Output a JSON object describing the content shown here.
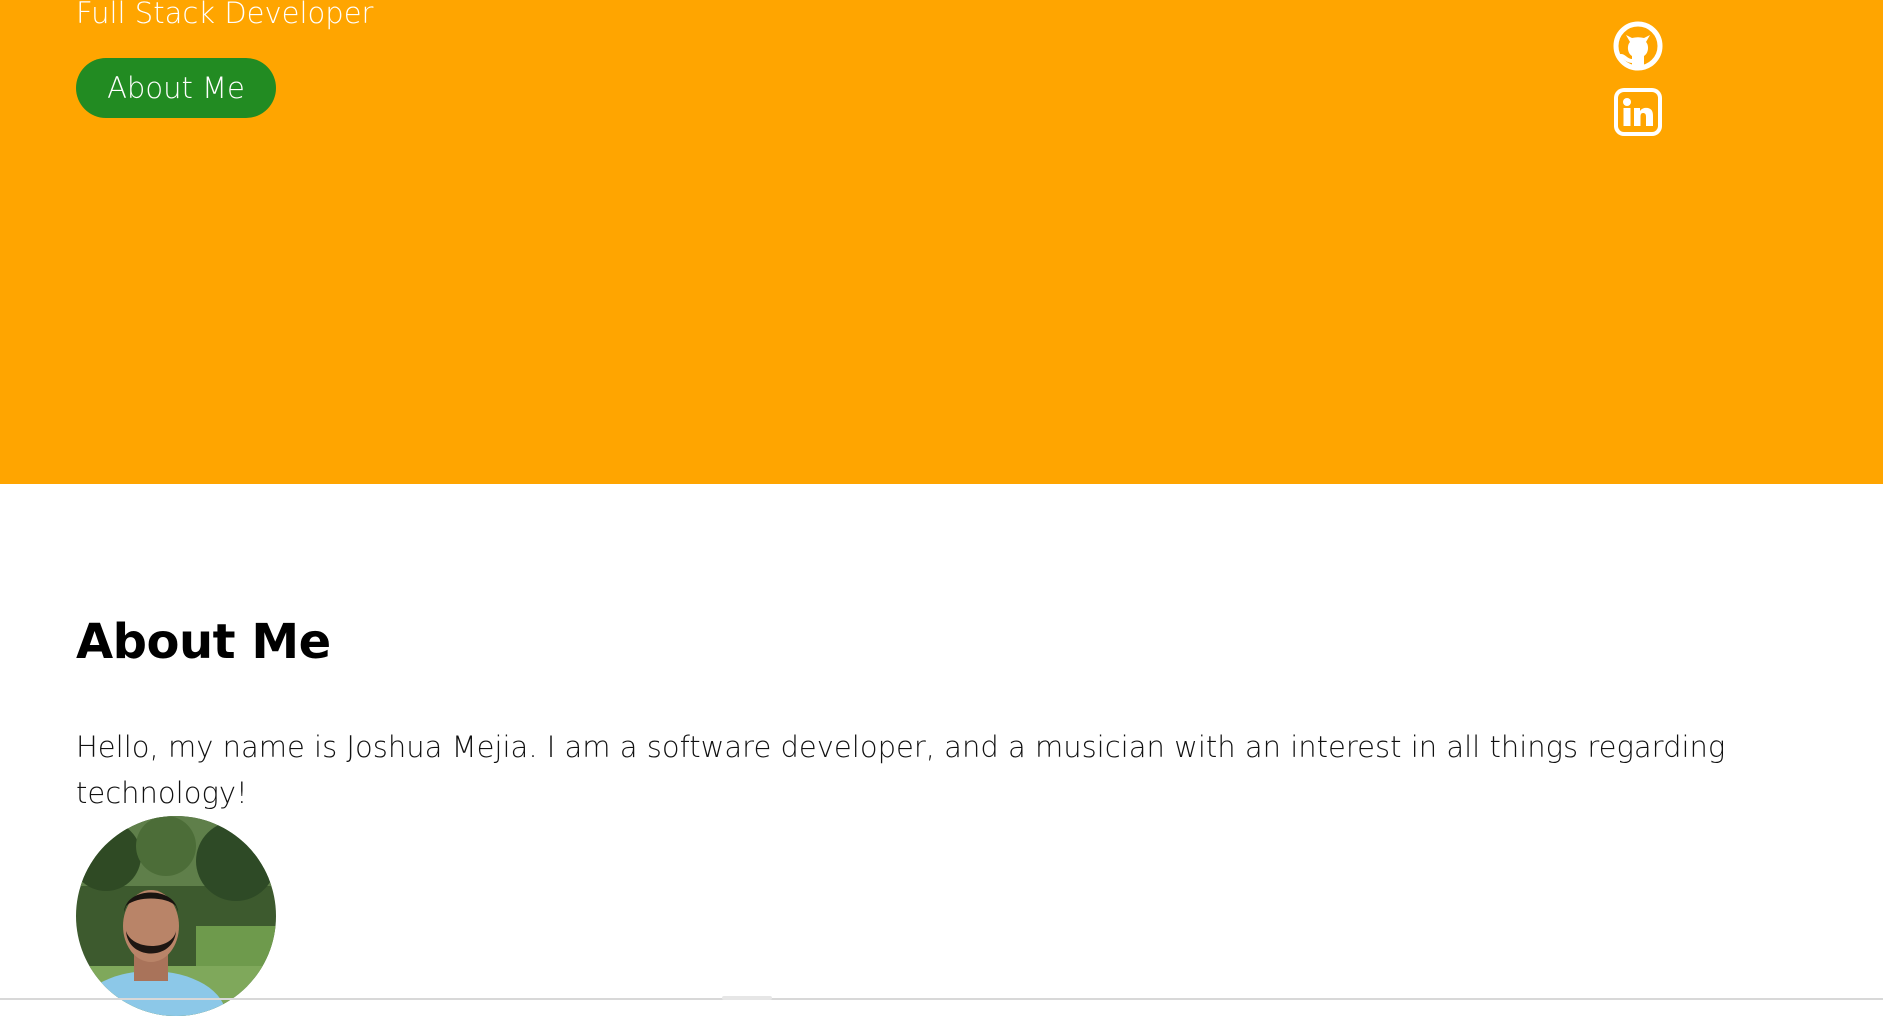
{
  "hero": {
    "subtitle": "Full Stack Developer",
    "about_button_label": "About Me",
    "background_color": "#ffa500",
    "button_color": "#228b22",
    "social_icons": [
      "github-icon",
      "linkedin-icon"
    ]
  },
  "about": {
    "heading": "About Me",
    "text": "Hello, my name is Joshua Mejia. I am a software developer, and a musician with an interest in all things regarding technology!",
    "avatar_alt": "Joshua Mejia"
  }
}
